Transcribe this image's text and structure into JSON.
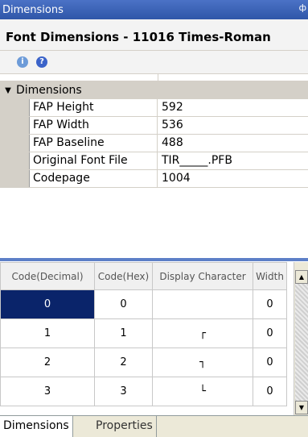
{
  "window": {
    "title": "Dimensions",
    "pin_glyph": "ф"
  },
  "header": {
    "title": "Font Dimensions - 11016  Times-Roman"
  },
  "toolbar": {
    "info_icon": "info-icon",
    "help_icon": "help-icon",
    "info_glyph": "i",
    "help_glyph": "?"
  },
  "propgrid": {
    "category": "Dimensions",
    "rows": [
      {
        "name": "FAP Height",
        "value": "592"
      },
      {
        "name": "FAP Width",
        "value": "536"
      },
      {
        "name": "FAP Baseline",
        "value": "488"
      },
      {
        "name": "Original Font File",
        "value": "TIR_____.PFB"
      },
      {
        "name": "Codepage",
        "value": "1004"
      }
    ]
  },
  "code_table": {
    "headers": [
      "Code(Decimal)",
      "Code(Hex)",
      "Display Character",
      "Width"
    ],
    "rows": [
      {
        "dec": "0",
        "hex": "0",
        "char": "",
        "width": "0"
      },
      {
        "dec": "1",
        "hex": "1",
        "char": "┌",
        "width": "0"
      },
      {
        "dec": "2",
        "hex": "2",
        "char": "┐",
        "width": "0"
      },
      {
        "dec": "3",
        "hex": "3",
        "char": "└",
        "width": "0"
      }
    ],
    "selected_row": 0
  },
  "tabs": [
    {
      "label": "Dimensions",
      "active": true
    },
    {
      "label": "Properties",
      "active": false
    }
  ],
  "colors": {
    "titlebar": "#2f56a8",
    "selection": "#0a246a",
    "splitter": "#5d7fc7"
  }
}
